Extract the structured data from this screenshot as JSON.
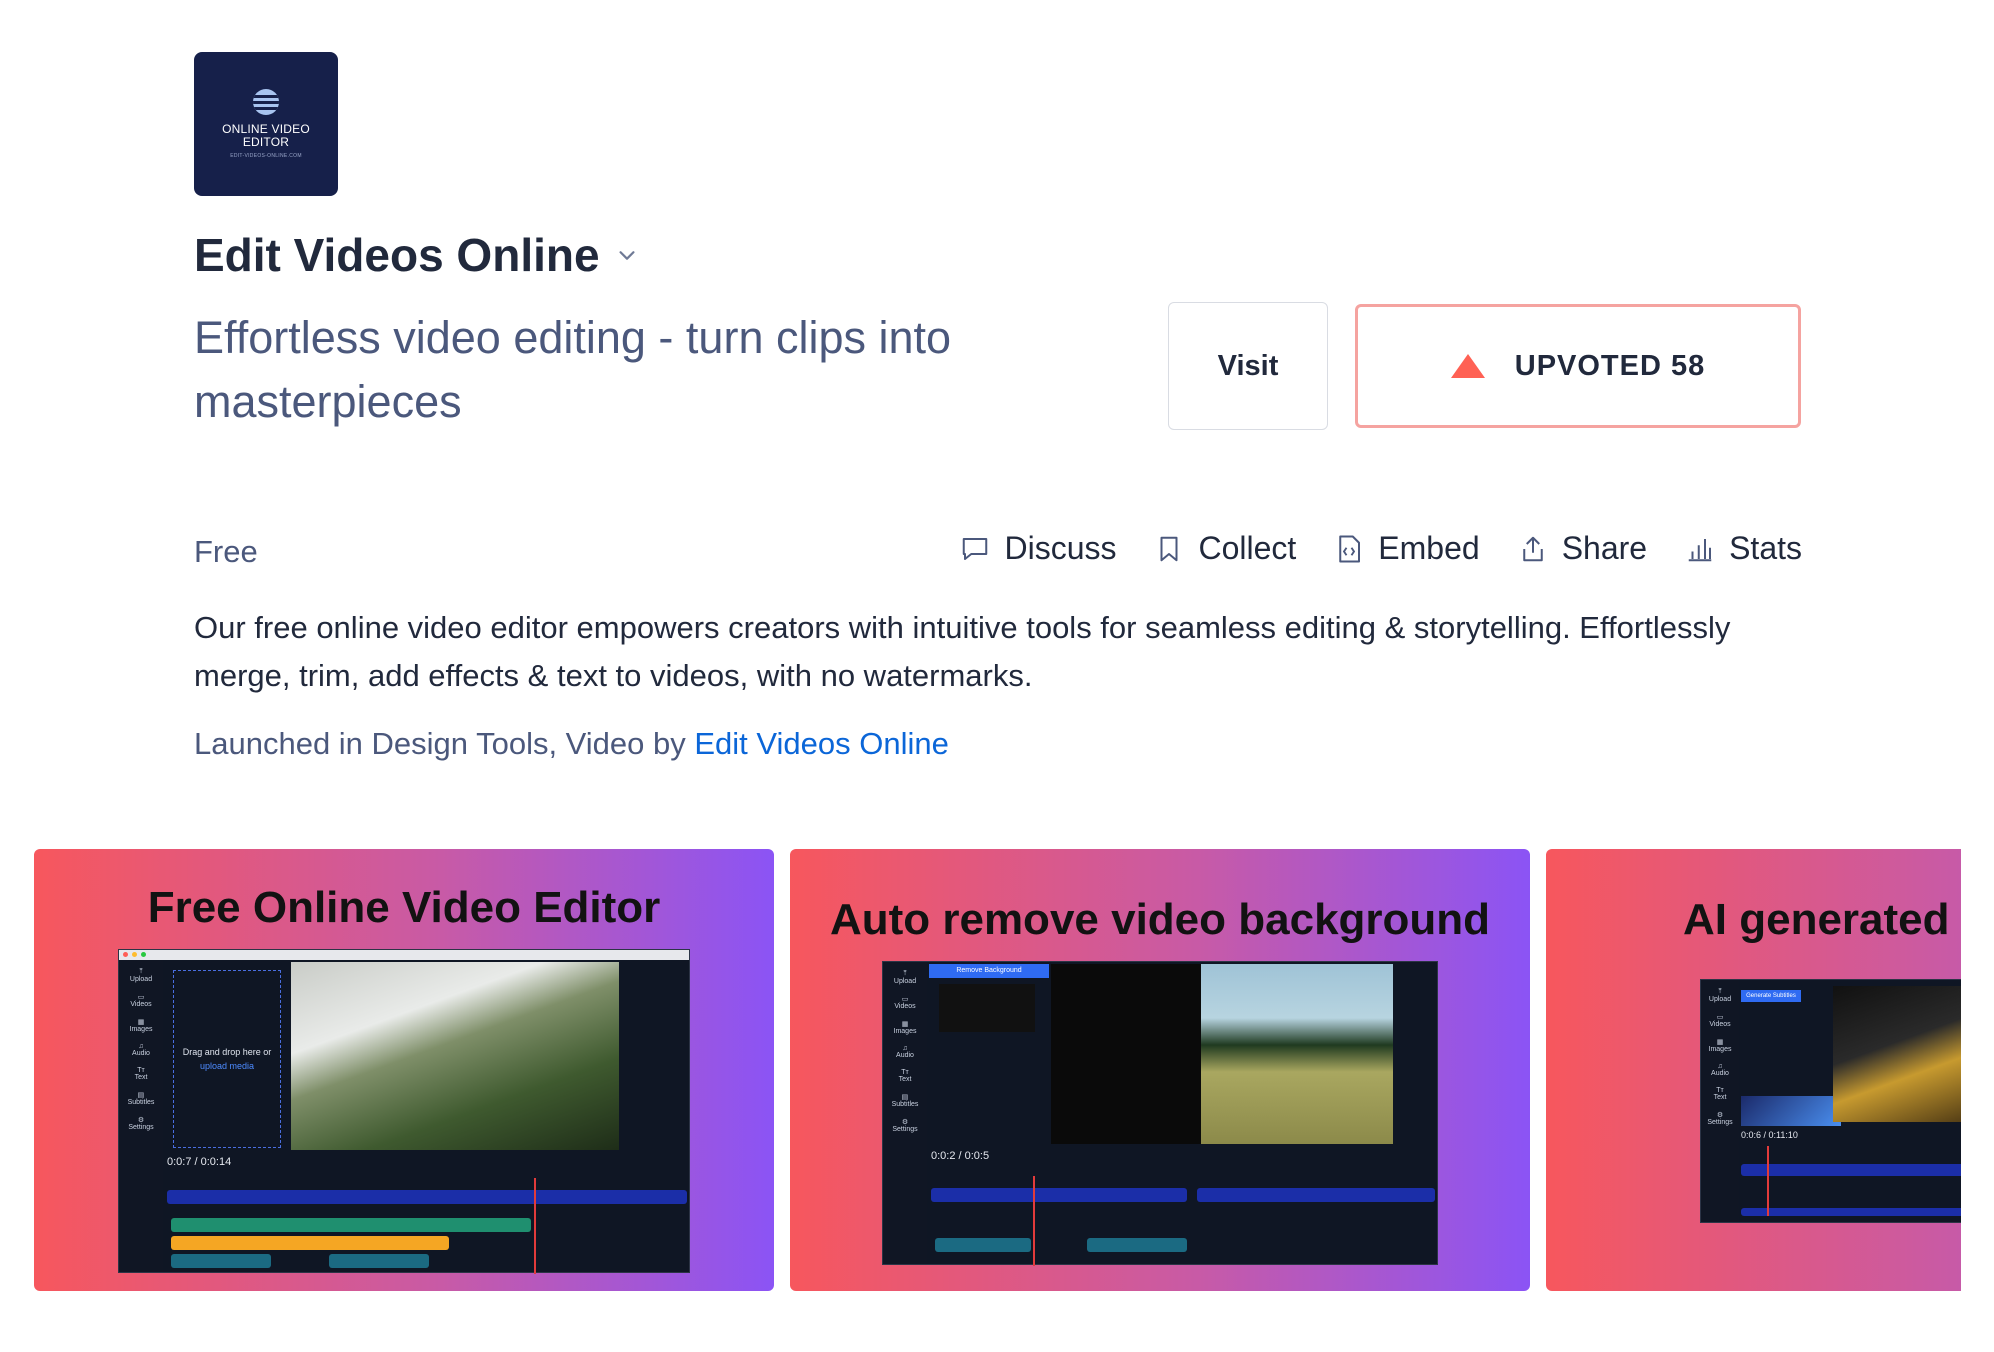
{
  "product": {
    "logo": {
      "line1": "ONLINE VIDEO",
      "line2": "EDITOR",
      "line3": "EDIT-VIDEOS-ONLINE.COM"
    },
    "name": "Edit Videos Online",
    "tagline": "Effortless video editing - turn clips into masterpieces",
    "visit_label": "Visit",
    "upvote_label": "UPVOTED 58",
    "pricing": "Free",
    "description": "Our free online video editor empowers creators with intuitive tools for seamless editing & storytelling. Effortlessly merge, trim, add effects & text to videos, with no watermarks.",
    "launched_prefix": "Launched in Design Tools, Video by ",
    "launched_link": "Edit Videos Online"
  },
  "actions": [
    {
      "label": "Discuss",
      "icon": "comment-icon"
    },
    {
      "label": "Collect",
      "icon": "bookmark-icon"
    },
    {
      "label": "Embed",
      "icon": "code-file-icon"
    },
    {
      "label": "Share",
      "icon": "share-icon"
    },
    {
      "label": "Stats",
      "icon": "bar-chart-icon"
    }
  ],
  "gallery": [
    {
      "title": "Free Online Video Editor",
      "time": "0:0:7 / 0:0:14",
      "drop_text": "Drag and drop here or",
      "drop_link": "upload media"
    },
    {
      "title": "Auto remove video background",
      "time": "0:0:2 / 0:0:5",
      "panel_label": "Remove Background"
    },
    {
      "title": "AI generated",
      "time": "0:0:6 / 0:11:10",
      "panel_label": "Generate Subtitles"
    }
  ],
  "colors": {
    "accent": "#ff6154",
    "upvote_border": "#f5a3a0",
    "link": "#0b66d8"
  }
}
